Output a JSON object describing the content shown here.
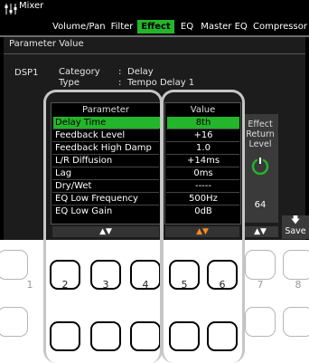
{
  "app": {
    "title": "Mixer"
  },
  "tabs": [
    {
      "label": "Volume/Pan",
      "active": false
    },
    {
      "label": "Filter",
      "active": false
    },
    {
      "label": "Effect",
      "active": true
    },
    {
      "label": "EQ",
      "active": false
    },
    {
      "label": "Master EQ",
      "active": false
    },
    {
      "label": "Compressor",
      "active": false
    }
  ],
  "section": {
    "title": "Parameter Value"
  },
  "dsp": {
    "name": "DSP1",
    "category_key": "Category",
    "category_value": "Delay",
    "type_key": "Type",
    "type_value": "Tempo Delay 1",
    "separator": ":"
  },
  "table": {
    "parameter_header": "Parameter",
    "value_header": "Value",
    "rows": [
      {
        "parameter": "Delay Time",
        "value": "8th",
        "selected": true
      },
      {
        "parameter": "Feedback Level",
        "value": "+16"
      },
      {
        "parameter": "Feedback High Damp",
        "value": "1.0"
      },
      {
        "parameter": "L/R Diffusion",
        "value": "+14ms"
      },
      {
        "parameter": "Lag",
        "value": "0ms"
      },
      {
        "parameter": "Dry/Wet",
        "value": "-----"
      },
      {
        "parameter": "EQ Low Frequency",
        "value": "500Hz"
      },
      {
        "parameter": "EQ Low Gain",
        "value": "0dB"
      }
    ],
    "param_arrows": "▲▼",
    "value_arrows": "▲▼"
  },
  "effect_return": {
    "label": "Effect Return Level",
    "value": "64",
    "arrows": "▲▼"
  },
  "save": {
    "label": "Save",
    "icon": "download-arrow-icon"
  },
  "buttons": [
    "1",
    "2",
    "3",
    "4",
    "5",
    "6",
    "7",
    "8"
  ],
  "colors": {
    "accent": "#23b52b",
    "arrow_active": "#ff8a1f"
  }
}
